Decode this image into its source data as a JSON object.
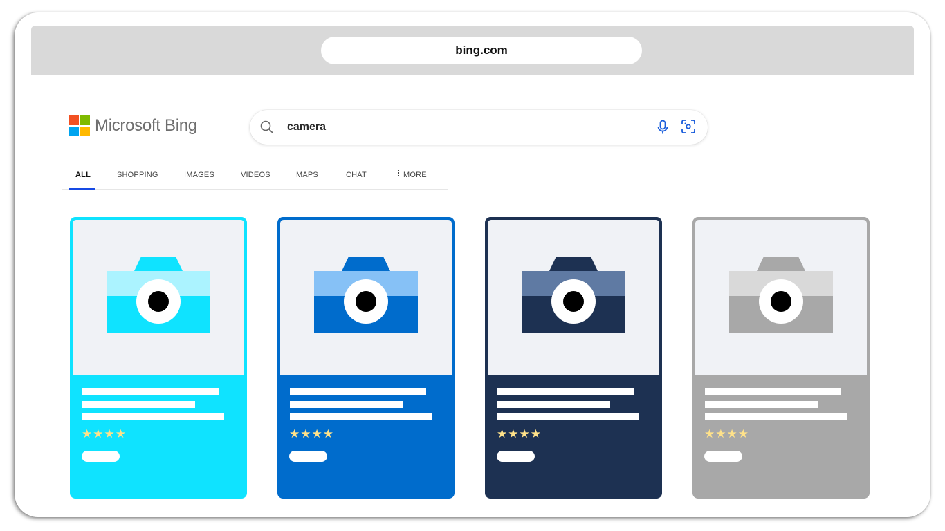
{
  "browser": {
    "url": "bing.com"
  },
  "logo": {
    "text": "Microsoft Bing",
    "squares": [
      "#f25022",
      "#7fba00",
      "#00a4ef",
      "#ffb900"
    ]
  },
  "search": {
    "query": "camera",
    "search_icon": "search-icon",
    "mic_icon": "microphone-icon",
    "visual_search_icon": "visual-search-icon",
    "accent_color": "#1a5ddb"
  },
  "tabs": [
    {
      "label": "ALL",
      "active": true
    },
    {
      "label": "SHOPPING",
      "active": false
    },
    {
      "label": "IMAGES",
      "active": false
    },
    {
      "label": "VIDEOS",
      "active": false
    },
    {
      "label": "MAPS",
      "active": false
    },
    {
      "label": "CHAT",
      "active": false
    },
    {
      "label": "MORE",
      "active": false,
      "icon": "vertical-dots-icon"
    }
  ],
  "active_tab_color": "#174ae4",
  "cards": [
    {
      "name": "cyan",
      "color": "#0fe3ff",
      "camera_top": "#abf3ff",
      "rating": 4,
      "stars": "★★★★",
      "star_color": "#ffe28a"
    },
    {
      "name": "blue",
      "color": "#006ccc",
      "camera_top": "#86c1f6",
      "rating": 4,
      "stars": "★★★★",
      "star_color": "#ffe28a"
    },
    {
      "name": "navy",
      "color": "#1d3152",
      "camera_top": "#5f7aa3",
      "rating": 4,
      "stars": "★★★★",
      "star_color": "#ffe28a"
    },
    {
      "name": "gray",
      "color": "#a8a8a8",
      "camera_top": "#d9d9d9",
      "rating": 4,
      "stars": "★★★★",
      "star_color": "#ffe28a"
    }
  ]
}
